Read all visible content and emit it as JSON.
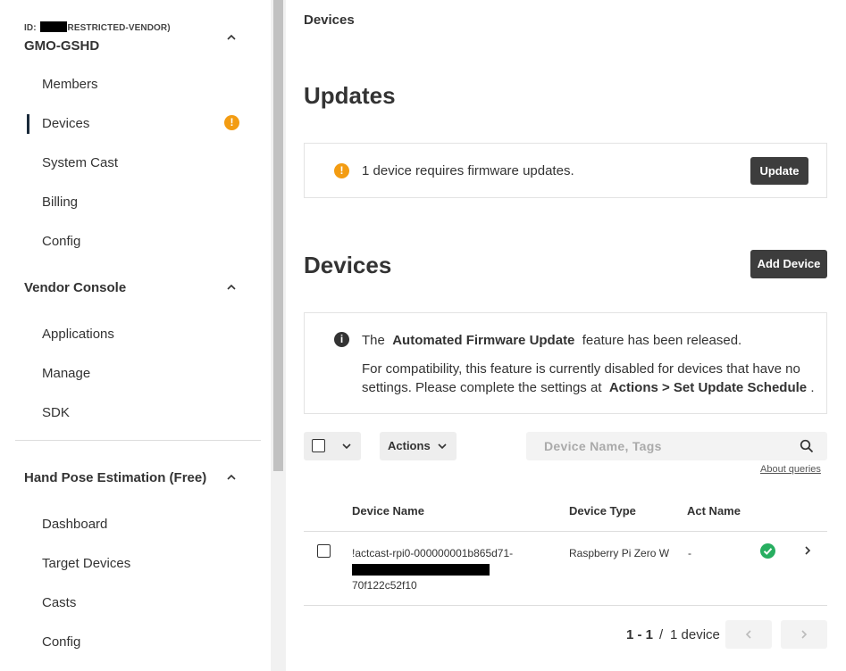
{
  "sidebar": {
    "org_id_prefix": "ID:",
    "org_id_suffix": "RESTRICTED-VENDOR)",
    "org_name": "GMO-GSHD",
    "org_items": [
      "Members",
      "Devices",
      "System Cast",
      "Billing",
      "Config"
    ],
    "vendor_title": "Vendor Console",
    "vendor_items": [
      "Applications",
      "Manage",
      "SDK"
    ],
    "app_title": "Hand Pose Estimation (Free)",
    "app_items": [
      "Dashboard",
      "Target Devices",
      "Casts",
      "Config"
    ],
    "warning_glyph": "!"
  },
  "main": {
    "breadcrumb": "Devices",
    "updates_heading": "Updates",
    "updates_message": "1 device requires firmware updates.",
    "update_button": "Update",
    "devices_heading": "Devices",
    "add_device_button": "Add Device",
    "notice": {
      "line1_pre": "The",
      "line1_bold": "Automated Firmware Update",
      "line1_post": "feature has been released.",
      "line2": "For compatibility, this feature is currently disabled for devices that have no",
      "line3_pre": "settings. Please complete the settings at",
      "line3_bold": "Actions > Set Update Schedule",
      "line3_post": "."
    },
    "actions_label": "Actions",
    "search_placeholder": "Device Name, Tags",
    "about_queries": "About queries",
    "table": {
      "headers": [
        "Device Name",
        "Device Type",
        "Act Name"
      ],
      "rows": [
        {
          "name_line1": "!actcast-rpi0-000000001b865d71-",
          "name_line3": "70f122c52f10",
          "type": "Raspberry Pi Zero W",
          "act": "-",
          "status": "ok"
        }
      ]
    },
    "pager": {
      "range": "1 - 1",
      "separator": "/",
      "total": "1 device"
    }
  },
  "colors": {
    "warning": "#f39c12",
    "success": "#27ae60",
    "dark_button": "#3d3d3d"
  }
}
